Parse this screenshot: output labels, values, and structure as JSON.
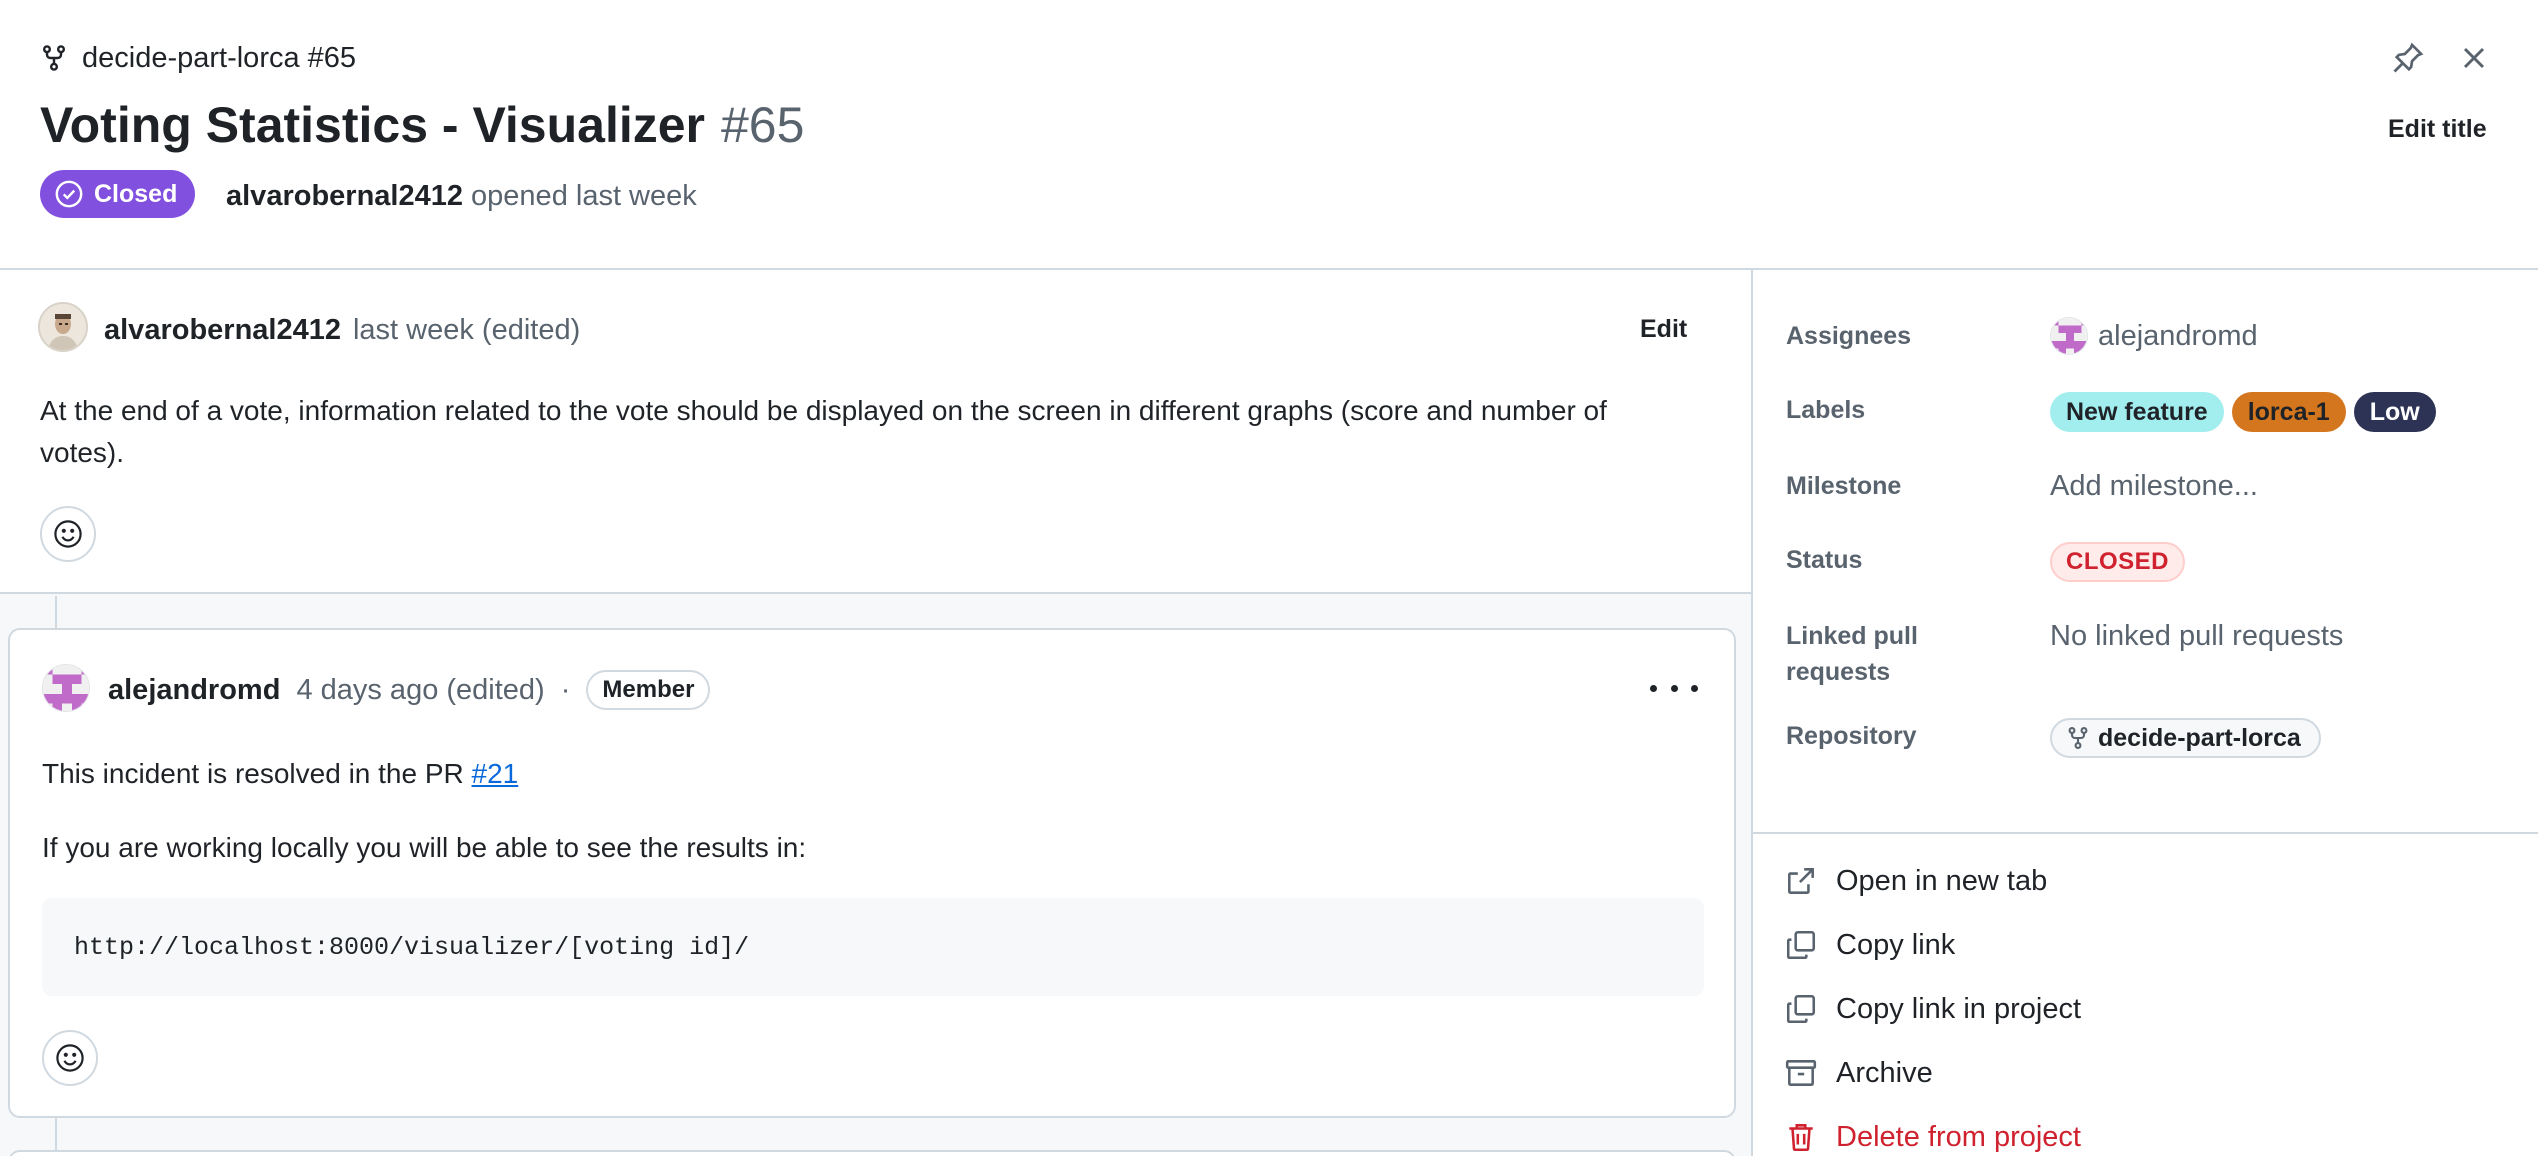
{
  "header": {
    "breadcrumb": "decide-part-lorca #65",
    "title": "Voting Statistics - Visualizer",
    "number": "#65",
    "state": "Closed",
    "opened_by": "alvarobernal2412",
    "opened_text": "opened last week",
    "edit_title_label": "Edit title"
  },
  "issue_body": {
    "author": "alvarobernal2412",
    "time": "last week (edited)",
    "edit_label": "Edit",
    "text": "At the end of a vote, information related to the vote should be displayed on the screen in different graphs (score and number of votes)."
  },
  "comment": {
    "author": "alejandromd",
    "time": "4 days ago (edited)",
    "separator": "·",
    "role": "Member",
    "line1_prefix": "This incident is resolved in the PR ",
    "line1_link": "#21",
    "line2": "If you are working locally you will be able to see the results in:",
    "code": "http://localhost:8000/visualizer/[voting id]/"
  },
  "sidebar": {
    "assignees_label": "Assignees",
    "assignee": "alejandromd",
    "labels_label": "Labels",
    "labels": [
      {
        "name": "New feature",
        "bg": "#a2eeef",
        "fg": "#1f2328"
      },
      {
        "name": "lorca-1",
        "bg": "#d4761e",
        "fg": "#1f2328"
      },
      {
        "name": "Low",
        "bg": "#2d3354",
        "fg": "#ffffff"
      }
    ],
    "milestone_label": "Milestone",
    "milestone_value": "Add milestone...",
    "status_label": "Status",
    "status_value": "CLOSED",
    "linked_label_1": "Linked pull",
    "linked_label_2": "requests",
    "linked_value": "No linked pull requests",
    "repository_label": "Repository",
    "repository_value": "decide-part-lorca",
    "actions": {
      "open_new_tab": "Open in new tab",
      "copy_link": "Copy link",
      "copy_link_project": "Copy link in project",
      "archive": "Archive",
      "delete": "Delete from project"
    }
  },
  "colors": {
    "closed_purple": "#8250df",
    "link_blue": "#0969da",
    "danger_red": "#cf222e",
    "border": "#d1d9e0"
  },
  "icons": [
    "repo-forked-icon",
    "pin-icon",
    "close-icon",
    "check-circle-icon",
    "smiley-icon",
    "kebab-horizontal-icon",
    "link-external-icon",
    "copy-icon",
    "archive-icon",
    "trash-icon"
  ]
}
